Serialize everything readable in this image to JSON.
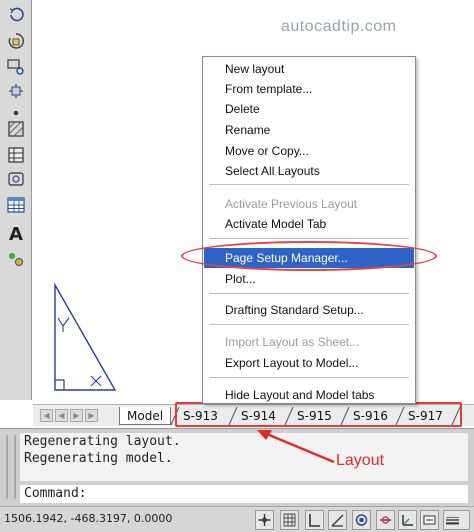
{
  "watermark": "autocadtip.com",
  "context_menu": {
    "items": [
      {
        "label": "New layout",
        "enabled": true
      },
      {
        "label": "From template...",
        "enabled": true
      },
      {
        "label": "Delete",
        "enabled": true
      },
      {
        "label": "Rename",
        "enabled": true
      },
      {
        "label": "Move or Copy...",
        "enabled": true
      },
      {
        "label": "Select All Layouts",
        "enabled": true
      },
      {
        "label": "Activate Previous Layout",
        "enabled": false
      },
      {
        "label": "Activate Model Tab",
        "enabled": true
      },
      {
        "label": "Page Setup Manager...",
        "enabled": true,
        "selected": true
      },
      {
        "label": "Plot...",
        "enabled": true
      },
      {
        "label": "Drafting Standard Setup...",
        "enabled": true
      },
      {
        "label": "Import Layout as Sheet...",
        "enabled": false
      },
      {
        "label": "Export Layout to Model...",
        "enabled": true
      },
      {
        "label": "Hide Layout and Model tabs",
        "enabled": true
      }
    ]
  },
  "tabs": {
    "model": "Model",
    "layouts": [
      "S-913",
      "S-914",
      "S-915",
      "S-916",
      "S-917"
    ]
  },
  "command": {
    "history": [
      "Regenerating layout.",
      "Regenerating model."
    ],
    "prompt": "Command:"
  },
  "annotation": {
    "label": "Layout"
  },
  "status": {
    "coordinates": "1506.1942, -468.3197, 0.0000"
  },
  "colors": {
    "highlight": "#2f63c8",
    "annotation_red": "#e02b2b"
  },
  "toolbar_icons": [
    "undo-icon",
    "rotate-icon",
    "zoom-window-icon",
    "move-icon",
    "point-icon",
    "hatch-icon",
    "table-grid-icon",
    "region-icon",
    "table-icon",
    "text-icon",
    "attribute-icon"
  ]
}
